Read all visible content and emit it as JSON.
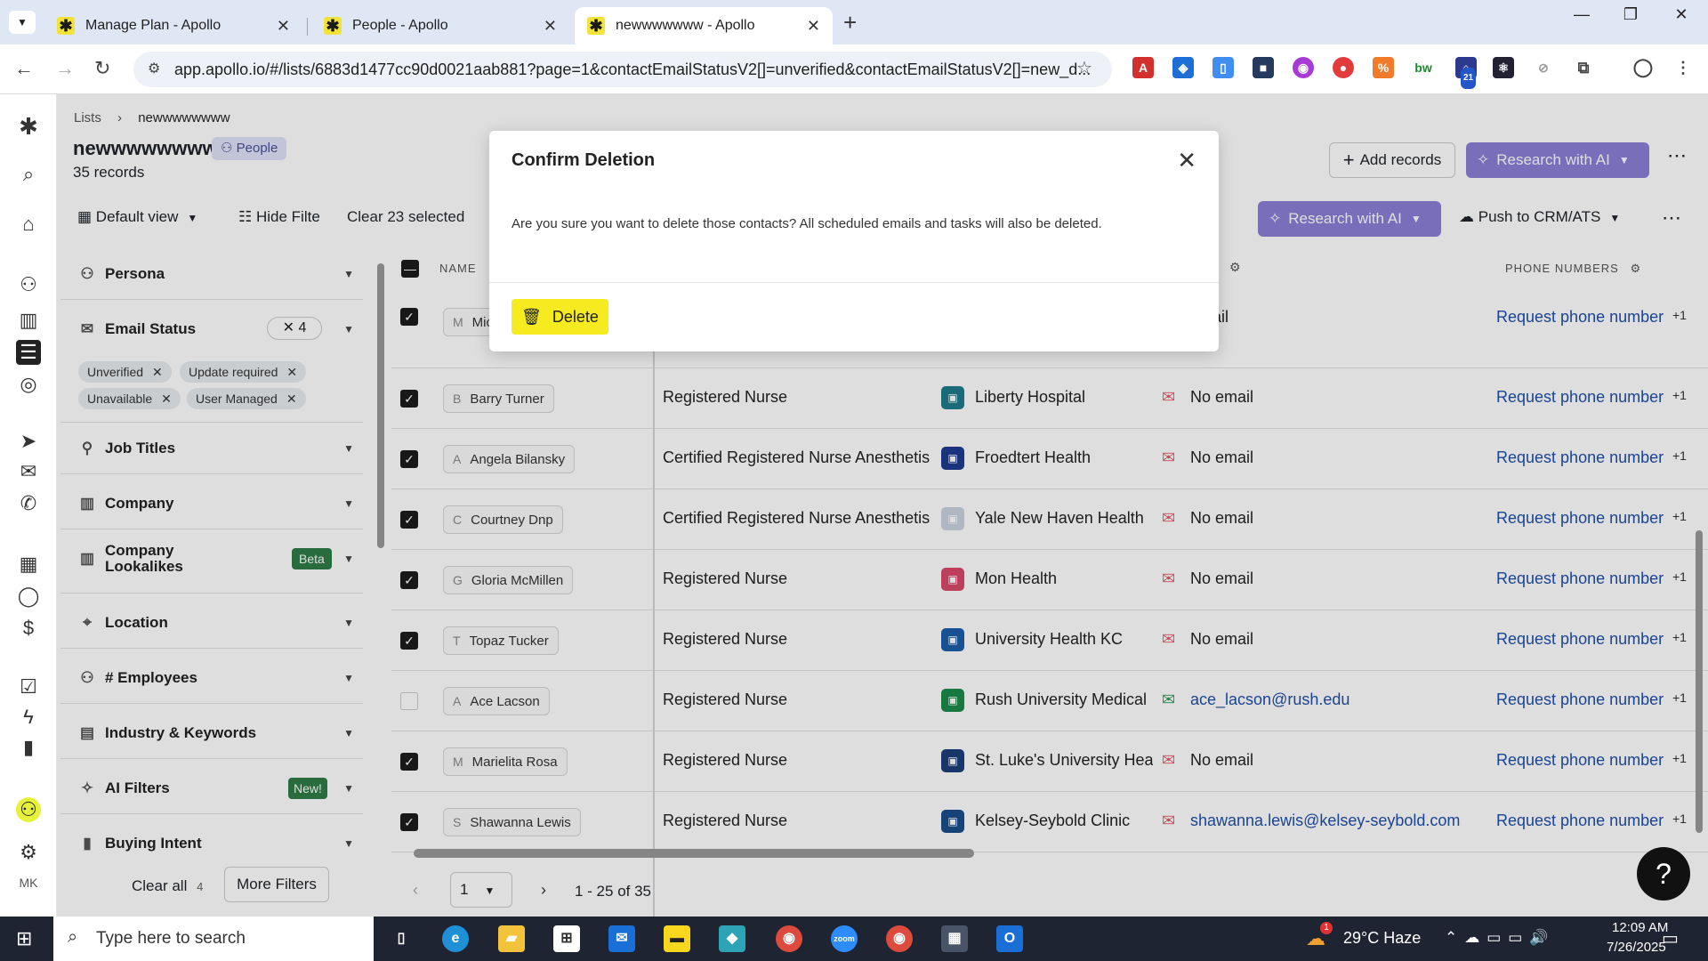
{
  "browser": {
    "tabs": [
      {
        "label": "Manage Plan - Apollo",
        "close": "✕"
      },
      {
        "label": "People - Apollo",
        "close": "✕"
      },
      {
        "label": "newwwwwww - Apollo",
        "close": "✕"
      }
    ],
    "new_tab": "+",
    "url": "app.apollo.io/#/lists/6883d1477cc90d0021aab881?page=1&contactEmailStatusV2[]=unverified&contactEmailStatusV2[]=new_d...",
    "ext_badge": "21"
  },
  "header": {
    "breadcrumb_root": "Lists",
    "breadcrumb_current": "newwwwwwww",
    "list_title": "newwwwwwww",
    "people_badge": "People",
    "record_count": "35 records",
    "add_records": "Add records",
    "research_ai": "Research with AI"
  },
  "toolbar": {
    "default_view": "Default view",
    "hide_filters": "Hide Filte",
    "clear_selected": "Clear 23 selected",
    "research_ai": "Research with AI",
    "push_crm": "Push to CRM/ATS"
  },
  "filters": {
    "persona": "Persona",
    "email_status": "Email Status",
    "email_status_count": "4",
    "chips": [
      "Unverified",
      "Update required",
      "Unavailable",
      "User Managed"
    ],
    "job_titles": "Job Titles",
    "company": "Company",
    "company_lookalikes": "Company Lookalikes",
    "beta": "Beta",
    "location": "Location",
    "employees": "# Employees",
    "industry": "Industry & Keywords",
    "ai_filters": "AI Filters",
    "new_badge": "New!",
    "buying_intent": "Buying Intent",
    "clear_all": "Clear all",
    "clear_all_count": "4",
    "more_filters": "More Filters"
  },
  "table": {
    "col_name": "NAME",
    "col_phone": "PHONE NUMBERS",
    "rows": [
      {
        "initial": "M",
        "name": "Mic",
        "title": "",
        "company": "",
        "email": "email",
        "email_ok": false,
        "phone": "Request phone number",
        "plus": "+1",
        "checked": true,
        "logo_color": "#ffffff"
      },
      {
        "initial": "B",
        "name": "Barry Turner",
        "title": "Registered Nurse",
        "company": "Liberty Hospital",
        "email": "No email",
        "email_ok": false,
        "phone": "Request phone number",
        "plus": "+1",
        "checked": true,
        "logo_color": "#1f7a8c"
      },
      {
        "initial": "A",
        "name": "Angela Bilansky",
        "title": "Certified Registered Nurse Anesthetis",
        "company": "Froedtert Health",
        "email": "No email",
        "email_ok": false,
        "phone": "Request phone number",
        "plus": "+1",
        "checked": true,
        "logo_color": "#1d3c8f"
      },
      {
        "initial": "C",
        "name": "Courtney Dnp",
        "title": "Certified Registered Nurse Anesthetis",
        "company": "Yale New Haven Health",
        "email": "No email",
        "email_ok": false,
        "phone": "Request phone number",
        "plus": "+1",
        "checked": true,
        "logo_color": "#c9d3e0"
      },
      {
        "initial": "G",
        "name": "Gloria McMillen",
        "title": "Registered Nurse",
        "company": "Mon Health",
        "email": "No email",
        "email_ok": false,
        "phone": "Request phone number",
        "plus": "+1",
        "checked": true,
        "logo_color": "#d84a6a"
      },
      {
        "initial": "T",
        "name": "Topaz Tucker",
        "title": "Registered Nurse",
        "company": "University Health KC",
        "email": "No email",
        "email_ok": false,
        "phone": "Request phone number",
        "plus": "+1",
        "checked": true,
        "logo_color": "#1b5ea8"
      },
      {
        "initial": "A",
        "name": "Ace Lacson",
        "title": "Registered Nurse",
        "company": "Rush University Medical",
        "email": "ace_lacson@rush.edu",
        "email_ok": true,
        "phone": "Request phone number",
        "plus": "+1",
        "checked": false,
        "logo_color": "#1b8a4a"
      },
      {
        "initial": "M",
        "name": "Marielita Rosa",
        "title": "Registered Nurse",
        "company": "St. Luke's University Heal",
        "email": "No email",
        "email_ok": false,
        "phone": "Request phone number",
        "plus": "+1",
        "checked": true,
        "logo_color": "#1d3f7a"
      },
      {
        "initial": "S",
        "name": "Shawanna Lewis",
        "title": "Registered Nurse",
        "company": "Kelsey-Seybold Clinic",
        "email": "shawanna.lewis@kelsey-seybold.com",
        "email_ok": false,
        "phone": "Request phone number",
        "plus": "+1",
        "checked": true,
        "logo_color": "#1a4f8c"
      }
    ]
  },
  "pagination": {
    "page": "1",
    "range": "1 - 25 of 35"
  },
  "modal": {
    "title": "Confirm Deletion",
    "body": "Are you sure you want to delete those contacts? All scheduled emails and tasks will also be deleted.",
    "delete_label": "Delete"
  },
  "rail": {
    "avatar": "MK"
  },
  "taskbar": {
    "search_placeholder": "Type here to search",
    "weather": "29°C Haze",
    "weather_badge": "1",
    "time": "12:09 AM",
    "date": "7/26/2025"
  },
  "colors": {
    "accent_yellow": "#f5eb1e",
    "purple": "#8b7fd6",
    "link_blue": "#1f4fa8"
  }
}
